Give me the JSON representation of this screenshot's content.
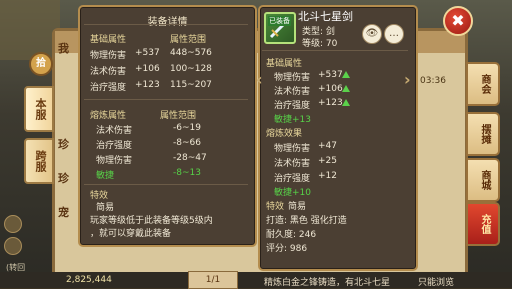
{
  "left_panel": {
    "title": "装备详情",
    "base_section": {
      "title": "基础属性",
      "range_title": "属性范围",
      "rows": [
        {
          "label": "物理伤害",
          "value": "+537",
          "range": "448~576"
        },
        {
          "label": "法术伤害",
          "value": "+106",
          "range": "100~128"
        },
        {
          "label": "治疗强度",
          "value": "+123",
          "range": "115~207"
        }
      ]
    },
    "forge_section": {
      "title": "熔炼属性",
      "range_title": "属性范围",
      "rows": [
        {
          "label": "法术伤害",
          "range": "-6~19",
          "highlight": false
        },
        {
          "label": "治疗强度",
          "range": "-8~66",
          "highlight": false
        },
        {
          "label": "物理伤害",
          "range": "-28~47",
          "highlight": false
        },
        {
          "label": "敏捷",
          "range": "-8~13",
          "highlight": true
        }
      ]
    },
    "special": {
      "title": "特效",
      "name": "简易"
    },
    "note_line1": "玩家等级低于此装备等级5级内",
    "note_line2": "，就可以穿戴此装备"
  },
  "right_panel": {
    "item_name": "北斗七星剑",
    "type_line": "类型: 剑",
    "level_line": "等级: 70",
    "equip_tag": "已装备",
    "base_title": "基础属性",
    "base_rows": [
      {
        "label": "物理伤害",
        "value": "+537"
      },
      {
        "label": "法术伤害",
        "value": "+106"
      },
      {
        "label": "治疗强度",
        "value": "+123"
      }
    ],
    "agility_line": "敏捷+13",
    "forge_title": "熔炼效果",
    "forge_rows": [
      {
        "label": "物理伤害",
        "value": "+47"
      },
      {
        "label": "法术伤害",
        "value": "+25"
      },
      {
        "label": "治疗强度",
        "value": "+12"
      }
    ],
    "forge_agility": "敏捷+10",
    "special_title": "特效",
    "special_name": "简易",
    "forge_by_line": "打造: 黑色  强化打造",
    "durability_line": "耐久度: 246",
    "score_line": "评分: 986",
    "bottom_line": "精炼白金之锋铸造，有北斗七星"
  },
  "back_window": {
    "rows": [
      "我",
      "珍",
      "珍",
      "宠"
    ],
    "time": "03:36",
    "page": "1/1",
    "currency": "2,825,444",
    "right_text": "只能浏览"
  },
  "left_tabs": [
    "本服",
    "跨服"
  ],
  "top_round": "拾",
  "right_tabs": [
    "商会",
    "摆摊",
    "商城",
    "充值"
  ],
  "close_label": "✖",
  "left_edge_text": "(转回",
  "colors": {
    "panel_bg": "#4b3f33",
    "panel_border": "#b48d4e",
    "highlight_green": "#57d148",
    "section_yellow": "#e8d79c",
    "close_red": "#d2392a"
  }
}
